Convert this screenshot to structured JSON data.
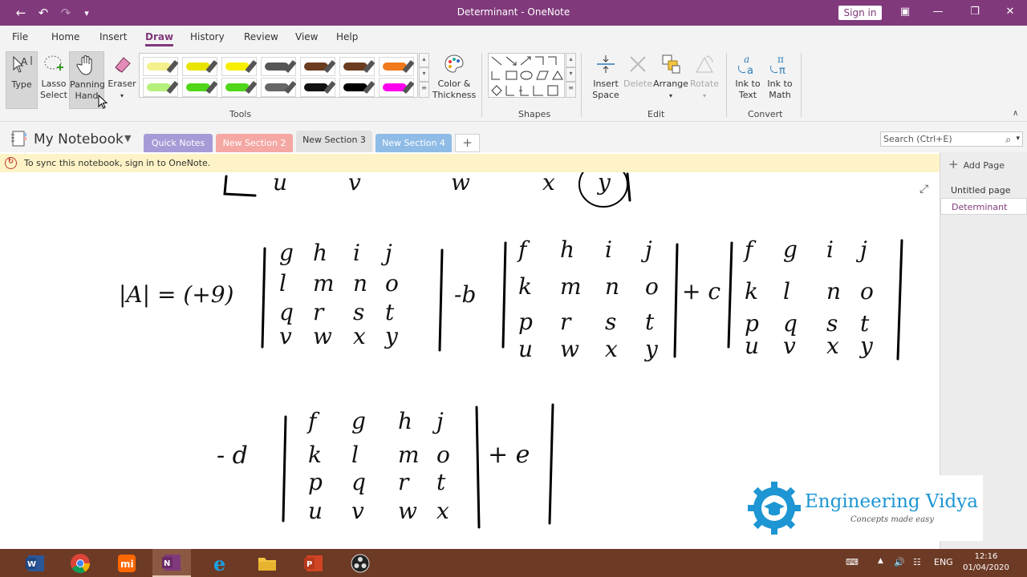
{
  "titlebar": {
    "title": "Determinant  -  OneNote",
    "signin": "Sign in"
  },
  "menu": {
    "tabs": [
      "File",
      "Home",
      "Insert",
      "Draw",
      "History",
      "Review",
      "View",
      "Help"
    ],
    "active": "Draw"
  },
  "ribbon": {
    "tools": {
      "type": "Type",
      "lasso": [
        "Lasso",
        "Select"
      ],
      "panning": [
        "Panning",
        "Hand"
      ],
      "eraser": "Eraser",
      "color_thickness": [
        "Color &",
        "Thickness"
      ],
      "group_label": "Tools"
    },
    "pens_row1": [
      "#f4f08c",
      "#e8e400",
      "#f8ef00",
      "#555555",
      "#6b3c1f",
      "#6b3c1f",
      "#f07a1c"
    ],
    "pens_row2": [
      "#b5f07a",
      "#4fd616",
      "#4fd616",
      "#666666",
      "#111111",
      "#000000",
      "#ff00ee"
    ],
    "shapes_label": "Shapes",
    "edit": {
      "insert_space": [
        "Insert",
        "Space"
      ],
      "delete": "Delete",
      "arrange": "Arrange",
      "rotate": "Rotate",
      "group_label": "Edit"
    },
    "convert": {
      "ink_to_text": [
        "Ink to",
        "Text"
      ],
      "ink_to_math": [
        "Ink to",
        "Math"
      ],
      "group_label": "Convert"
    }
  },
  "notebook": {
    "name": "My Notebook",
    "sections": [
      {
        "label": "Quick Notes",
        "color": "#a89ad6"
      },
      {
        "label": "New Section 2",
        "color": "#f4a7a3"
      },
      {
        "label": "New Section 3",
        "color": "#e1e1e1"
      },
      {
        "label": "New Section 4",
        "color": "#8fbce6"
      }
    ],
    "add_section": "+",
    "search_placeholder": "Search (Ctrl+E)"
  },
  "sync": {
    "message": "To sync this notebook, sign in to OneNote."
  },
  "pages": {
    "add_label": "Add Page",
    "items": [
      "Untitled page",
      "Determinant"
    ],
    "active": "Determinant"
  },
  "ink": {
    "top_row": [
      "u",
      "v",
      "w",
      "x",
      "y"
    ],
    "lhs": "|A| = (+9)",
    "m1": [
      [
        "g",
        "h",
        "i",
        "j"
      ],
      [
        "l",
        "m",
        "n",
        "o"
      ],
      [
        "q",
        "r",
        "s",
        "t"
      ],
      [
        "v",
        "w",
        "x",
        "y"
      ]
    ],
    "c1": "-b",
    "m2": [
      [
        "f",
        "h",
        "i",
        "j"
      ],
      [
        "k",
        "m",
        "n",
        "o"
      ],
      [
        "p",
        "r",
        "s",
        "t"
      ],
      [
        "u",
        "w",
        "x",
        "y"
      ]
    ],
    "c2": "+ c",
    "m3": [
      [
        "f",
        "g",
        "i",
        "j"
      ],
      [
        "k",
        "l",
        "n",
        "o"
      ],
      [
        "p",
        "q",
        "s",
        "t"
      ],
      [
        "u",
        "v",
        "x",
        "y"
      ]
    ],
    "c3": "- d",
    "m4": [
      [
        "f",
        "g",
        "h",
        "j"
      ],
      [
        "k",
        "l",
        "m",
        "o"
      ],
      [
        "p",
        "q",
        "r",
        "t"
      ],
      [
        "u",
        "v",
        "w",
        "x"
      ]
    ],
    "c4": "+ e"
  },
  "logo": {
    "title": "Engineering Vidya",
    "tagline": "Concepts made easy"
  },
  "taskbar": {
    "apps": [
      "word",
      "chrome",
      "mi",
      "onenote",
      "edge",
      "explorer",
      "powerpoint",
      "obs"
    ],
    "lang": "ENG",
    "time": "12:16",
    "date": "01/04/2020"
  }
}
